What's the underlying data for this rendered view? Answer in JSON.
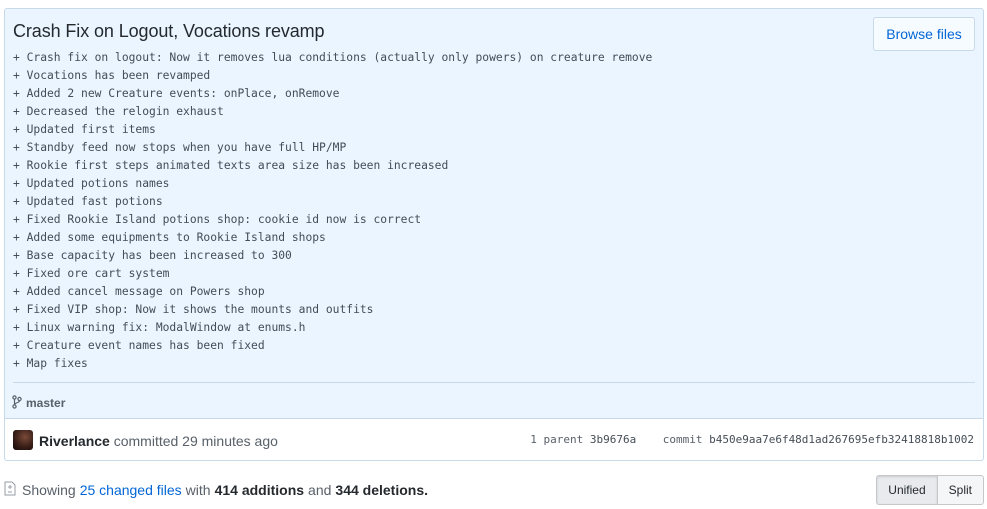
{
  "commit": {
    "title": "Crash Fix on Logout, Vocations revamp",
    "browse_label": "Browse files",
    "description_lines": [
      "+ Crash fix on logout: Now it removes lua conditions (actually only powers) on creature remove",
      "+ Vocations has been revamped",
      "+ Added 2 new Creature events: onPlace, onRemove",
      "+ Decreased the relogin exhaust",
      "+ Updated first items",
      "+ Standby feed now stops when you have full HP/MP",
      "+ Rookie first steps animated texts area size has been increased",
      "+ Updated potions names",
      "+ Updated fast potions",
      "+ Fixed Rookie Island potions shop: cookie id now is correct",
      "+ Added some equipments to Rookie Island shops",
      "+ Base capacity has been increased to 300",
      "+ Fixed ore cart system",
      "+ Added cancel message on Powers shop",
      "+ Fixed VIP shop: Now it shows the mounts and outfits",
      "+ Linux warning fix: ModalWindow at enums.h",
      "+ Creature event names has been fixed",
      "+ Map fixes"
    ],
    "branch": "master",
    "author": "Riverlance",
    "committed_text": "committed 29 minutes ago",
    "parent_label": "1 parent",
    "parent_sha": "3b9676a",
    "commit_label": "commit",
    "commit_sha": "b450e9aa7e6f48d1ad267695efb32418818b1002"
  },
  "summary": {
    "prefix": "Showing",
    "changed_files": "25 changed files",
    "with": "with",
    "additions": "414 additions",
    "and": "and",
    "deletions": "344 deletions."
  },
  "diff_view": {
    "unified_label": "Unified",
    "split_label": "Split",
    "selected": "Unified"
  },
  "icons": {
    "branch": "git-branch-icon",
    "file_diff": "file-diff-icon"
  },
  "colors": {
    "header_bg": "#eaf5ff",
    "border": "#c8d9e8",
    "link": "#0366d6",
    "text": "#24292e",
    "muted": "#586069"
  }
}
